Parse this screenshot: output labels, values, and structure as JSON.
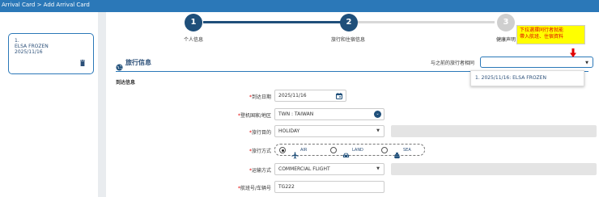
{
  "header": {
    "title": "Arrival Card > Add Arrival Card"
  },
  "card": {
    "index": "1.",
    "name": "ELSA FROZEN",
    "date": "2025/11/16"
  },
  "steps": [
    {
      "number": "1",
      "label": "个人信息",
      "state": "done"
    },
    {
      "number": "2",
      "label": "旅行和住宿信息",
      "state": "active"
    },
    {
      "number": "3",
      "label": "健康声明",
      "state": "pending"
    }
  ],
  "section": {
    "title": "旅行信息",
    "copy_label": "与之前的旅行者相同",
    "copy_value": "",
    "subheading": "到达信息"
  },
  "dropdown": {
    "options": [
      "1. 2025/11/16: ELSA FROZEN"
    ]
  },
  "callout": {
    "line1": "下拉選擇同行者就能",
    "line2": "帶入航班、住宿資料"
  },
  "form": {
    "arrival_date": {
      "label": "到达日期",
      "value": "2025/11/16"
    },
    "boarding_country": {
      "label": "登机国家/地区",
      "value": "TWN : TAIWAN"
    },
    "purpose": {
      "label": "旅行目的",
      "value": "HOLIDAY"
    },
    "travel_mode": {
      "label": "旅行方式",
      "options": [
        "AIR",
        "LAND",
        "SEA"
      ],
      "selected": "AIR"
    },
    "transport": {
      "label": "运输方式",
      "value": "COMMERCIAL FLIGHT"
    },
    "flight_no": {
      "label": "航班号/车辆号",
      "value": "TG222"
    }
  },
  "colors": {
    "primary": "#2b78b8",
    "dark": "#1f4f7a",
    "callout_bg": "#ffff00",
    "callout_text": "#e00000"
  }
}
